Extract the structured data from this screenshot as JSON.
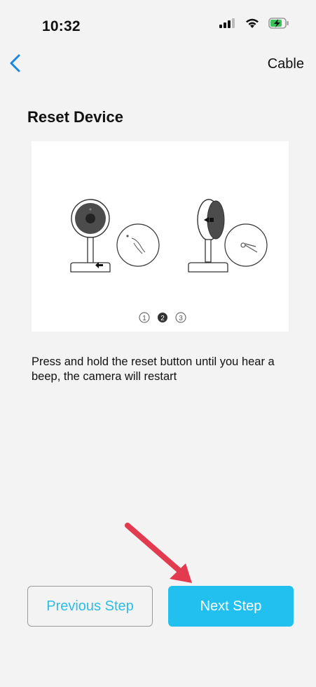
{
  "status": {
    "time": "10:32"
  },
  "nav": {
    "right_label": "Cable"
  },
  "page": {
    "title": "Reset Device"
  },
  "illustration": {
    "steps": [
      "1",
      "2",
      "3"
    ],
    "current_step": 2
  },
  "instruction": "Press and hold the reset button until you hear a beep, the camera will restart",
  "buttons": {
    "previous": "Previous Step",
    "next": "Next Step"
  },
  "colors": {
    "accent": "#22c0ee",
    "back_icon": "#1a86e0",
    "annotation": "#e23a4e"
  }
}
